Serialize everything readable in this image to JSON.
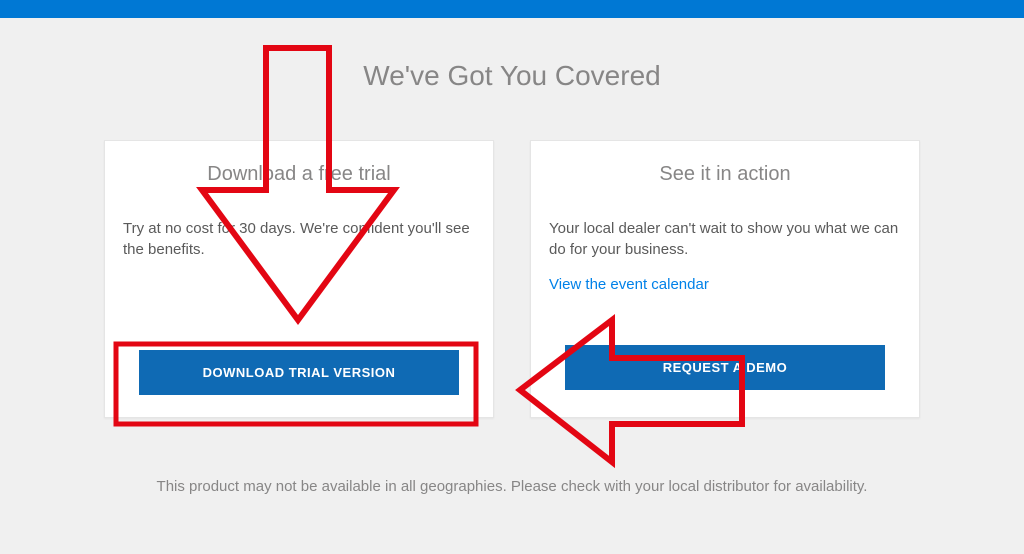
{
  "heading": "We've Got You Covered",
  "cards": {
    "trial": {
      "title": "Download a free trial",
      "desc": "Try at no cost for 30 days. We're confident you'll see the benefits.",
      "button_label": "DOWNLOAD TRIAL VERSION"
    },
    "demo": {
      "title": "See it in action",
      "desc": "Your local dealer can't wait to show you what we can do for your business.",
      "link_label": "View the event calendar",
      "button_label": "REQUEST A DEMO"
    }
  },
  "footer": "This product may not be available in all geographies. Please check with your local distributor for availability.",
  "accent_color": "#0c6fb6",
  "annotation_color": "#e30613"
}
